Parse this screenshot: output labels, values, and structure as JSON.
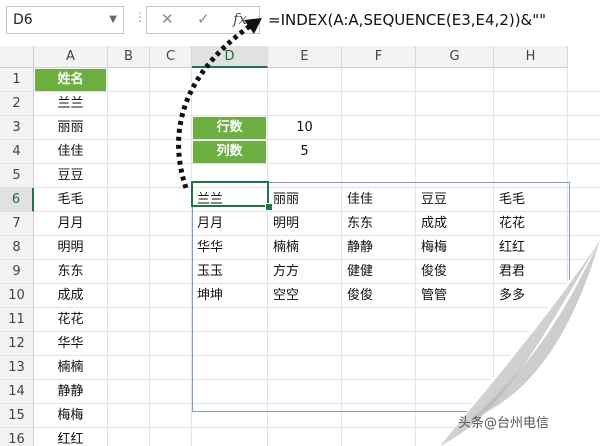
{
  "formula_bar": {
    "name_box": "D6",
    "dropdown_icon": "chevron-down-icon",
    "cancel_icon": "✕",
    "enter_icon": "✓",
    "function_icon": "fx",
    "formula": "=INDEX(A:A,SEQUENCE(E3,E4,2))&\"\""
  },
  "columns": [
    "A",
    "B",
    "C",
    "D",
    "E",
    "F",
    "G",
    "H"
  ],
  "active_column": "D",
  "rows": [
    "1",
    "2",
    "3",
    "4",
    "5",
    "6",
    "7",
    "8",
    "9",
    "10",
    "11",
    "12",
    "13",
    "14",
    "15",
    "16"
  ],
  "active_row": "6",
  "column_a": [
    "姓名",
    "兰兰",
    "丽丽",
    "佳佳",
    "豆豆",
    "毛毛",
    "月月",
    "明明",
    "东东",
    "成成",
    "花花",
    "华华",
    "楠楠",
    "静静",
    "梅梅",
    "红红"
  ],
  "params": {
    "rows_label": "行数",
    "rows_value": "10",
    "cols_label": "列数",
    "cols_value": "5"
  },
  "spill": [
    [
      "兰兰",
      "丽丽",
      "佳佳",
      "豆豆",
      "毛毛"
    ],
    [
      "月月",
      "明明",
      "东东",
      "成成",
      "花花"
    ],
    [
      "华华",
      "楠楠",
      "静静",
      "梅梅",
      "红红"
    ],
    [
      "玉玉",
      "方方",
      "健健",
      "俊俊",
      "君君"
    ],
    [
      "坤坤",
      "空空",
      "俊俊",
      "管管",
      "多多"
    ]
  ],
  "watermark": "头条@台州电信",
  "colors": {
    "header_green": "#6cae3f",
    "selection": "#217346",
    "spill_border": "#7d9fc6"
  }
}
